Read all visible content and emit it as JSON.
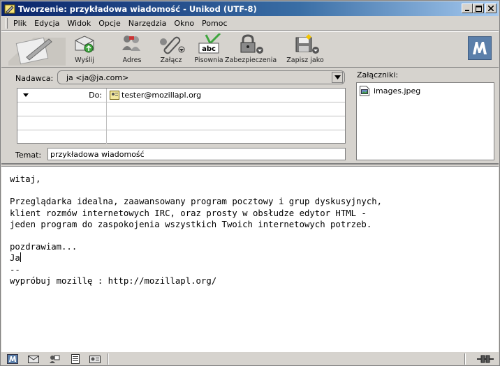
{
  "window": {
    "title": "Tworzenie: przykładowa wiadomość - Unikod (UTF-8)",
    "controls": {
      "minimize": "_",
      "maximize": "□",
      "close": "✕"
    }
  },
  "menu": [
    "Plik",
    "Edycja",
    "Widok",
    "Opcje",
    "Narzędzia",
    "Okno",
    "Pomoc"
  ],
  "toolbar": {
    "buttons": [
      {
        "label": "Wyślij",
        "icon": "send-icon"
      },
      {
        "label": "Adres",
        "icon": "address-icon"
      },
      {
        "label": "Załącz",
        "icon": "attach-icon"
      },
      {
        "label": "Pisownia",
        "icon": "spelling-icon"
      },
      {
        "label": "Zabezpieczenia",
        "icon": "security-icon"
      },
      {
        "label": "Zapisz jako",
        "icon": "save-icon"
      }
    ]
  },
  "compose": {
    "sender_label": "Nadawca:",
    "sender_value": "ja <ja@ja.com>",
    "recipients": [
      {
        "type": "Do:",
        "address": "tester@mozillapl.org"
      }
    ],
    "subject_label": "Temat:",
    "subject_value": "przykładowa wiadomość",
    "attachments_label": "Załączniki:",
    "attachments": [
      "images.jpeg"
    ]
  },
  "body": {
    "before_cursor": "witaj,\n\nPrzeglądarka idealna, zaawansowany program pocztowy i grup dyskusyjnych,\nklient rozmów internetowych IRC, oraz prosty w obsłudze edytor HTML -\njeden program do zaspokojenia wszystkich Twoich internetowych potrzeb.\n\npozdrawiam...\nJa",
    "after_cursor": "\n--\nwypróbuj mozillę : http://mozillapl.org/"
  },
  "colors": {
    "titlebar_start": "#0a246a",
    "titlebar_end": "#a6caf0",
    "chrome": "#d6d3ce"
  }
}
